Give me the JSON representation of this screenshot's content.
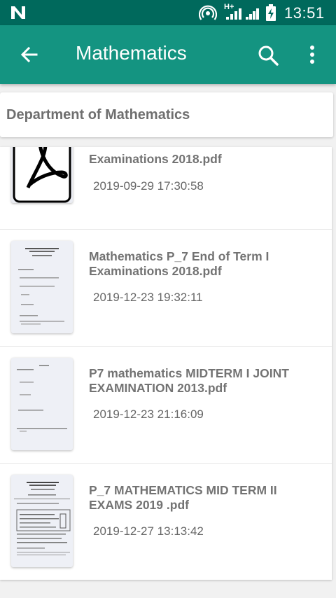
{
  "status_bar": {
    "network": "H+",
    "time": "13:51",
    "icons": [
      "n-logo-icon",
      "hotspot-icon",
      "signal-icon",
      "signal-icon",
      "battery-charging-icon"
    ]
  },
  "toolbar": {
    "title": "Mathematics",
    "back_icon": "arrow-back-icon",
    "search_icon": "search-icon",
    "more_icon": "more-vert-icon"
  },
  "department": {
    "title": "Department of Mathematics"
  },
  "files": [
    {
      "name": "Examinations 2018.pdf",
      "date": "2019-09-29 17:30:58",
      "thumbnail": "pdf-logo-icon"
    },
    {
      "name": "Mathematics P_7 End of Term I Examinations 2018.pdf",
      "date": "2019-12-23 19:32:11",
      "thumbnail": "document-page"
    },
    {
      "name": "P7 mathematics MIDTERM I JOINT EXAMINATION 2013.pdf",
      "date": "2019-12-23 21:16:09",
      "thumbnail": "document-page"
    },
    {
      "name": "P_7 MATHEMATICS MID TERM II EXAMS 2019 .pdf",
      "date": "2019-12-27 13:13:42",
      "thumbnail": "document-page"
    }
  ],
  "colors": {
    "status_bar": "#00695c",
    "toolbar": "#149481",
    "background": "#f1f1f1"
  }
}
